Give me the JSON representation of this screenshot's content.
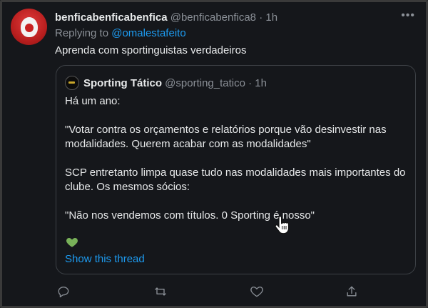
{
  "tweet": {
    "display_name": "benficabenficabenfica",
    "handle": "@benficabenfica8",
    "time": "· 1h",
    "replying_prefix": "Replying to",
    "replying_handle": "@omalestafeito",
    "text": "Aprenda com sportinguistas verdadeiros"
  },
  "quote": {
    "display_name": "Sporting Tático",
    "handle": "@sporting_tatico",
    "time": "· 1h",
    "lines": [
      "Há um ano:",
      "\"Votar contra os orçamentos e relatórios porque vão desinvestir nas modalidades. Querem acabar com as modalidades\"",
      "SCP entretanto limpa quase tudo nas modalidades mais importantes do clube. Os mesmos sócios:",
      "\"Não nos vendemos com títulos. 0 Sporting é nosso\""
    ],
    "emoji": "green-heart",
    "show_thread": "Show this thread"
  },
  "icons": {
    "more": "more-icon",
    "reply": "reply-icon",
    "retweet": "retweet-icon",
    "like": "like-icon",
    "share": "share-icon"
  },
  "colors": {
    "accent": "#1d9bf0",
    "background": "#15171b",
    "heart_green": "#78b159"
  }
}
